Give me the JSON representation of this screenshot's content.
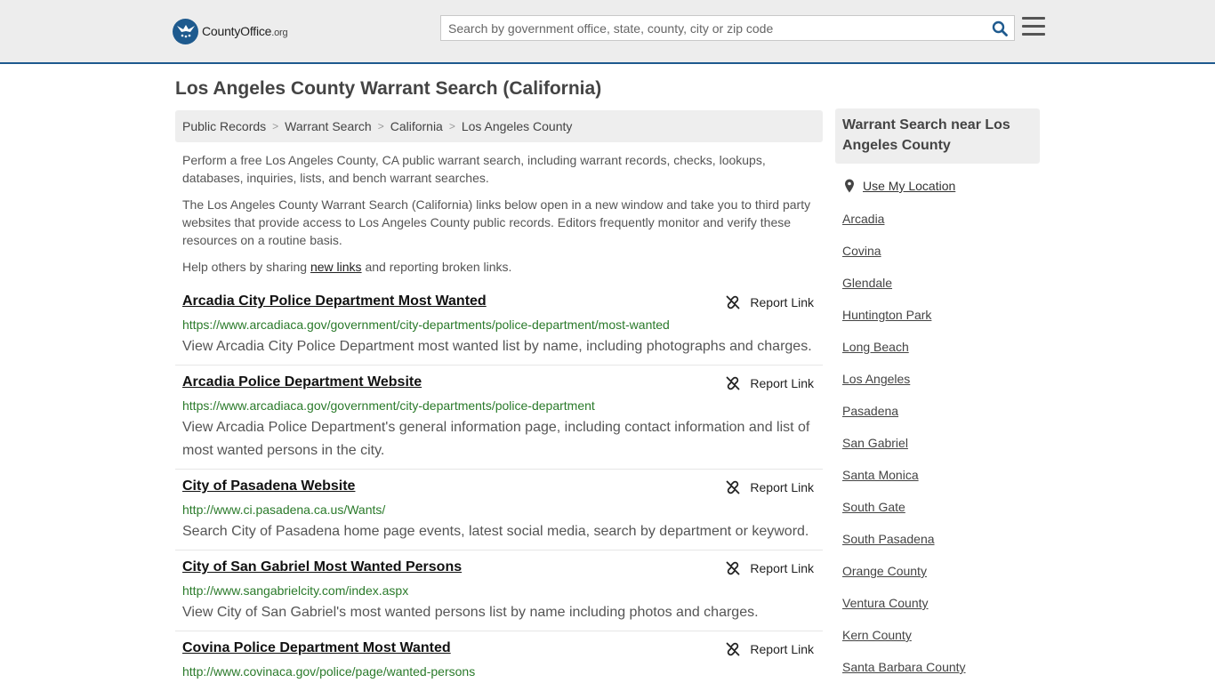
{
  "header": {
    "logo_name": "CountyOffice",
    "logo_tld": ".org",
    "search_placeholder": "Search by government office, state, county, city or zip code"
  },
  "page": {
    "title": "Los Angeles County Warrant Search (California)"
  },
  "breadcrumb": [
    "Public Records",
    "Warrant Search",
    "California",
    "Los Angeles County"
  ],
  "intro": {
    "p1": "Perform a free Los Angeles County, CA public warrant search, including warrant records, checks, lookups, databases, inquiries, lists, and bench warrant searches.",
    "p2": "The Los Angeles County Warrant Search (California) links below open in a new window and take you to third party websites that provide access to Los Angeles County public records. Editors frequently monitor and verify these resources on a routine basis.",
    "p3_before": "Help others by sharing ",
    "p3_link": "new links",
    "p3_after": " and reporting broken links."
  },
  "report_label": "Report Link",
  "results": [
    {
      "title": "Arcadia City Police Department Most Wanted",
      "url": "https://www.arcadiaca.gov/government/city-departments/police-department/most-wanted",
      "desc": "View Arcadia City Police Department most wanted list by name, including photographs and charges."
    },
    {
      "title": "Arcadia Police Department Website",
      "url": "https://www.arcadiaca.gov/government/city-departments/police-department",
      "desc": "View Arcadia Police Department's general information page, including contact information and list of most wanted persons in the city."
    },
    {
      "title": "City of Pasadena Website",
      "url": "http://www.ci.pasadena.ca.us/Wants/",
      "desc": "Search City of Pasadena home page events, latest social media, search by department or keyword."
    },
    {
      "title": "City of San Gabriel Most Wanted Persons",
      "url": "http://www.sangabrielcity.com/index.aspx",
      "desc": "View City of San Gabriel's most wanted persons list by name including photos and charges."
    },
    {
      "title": "Covina Police Department Most Wanted",
      "url": "http://www.covinaca.gov/police/page/wanted-persons",
      "desc": ""
    }
  ],
  "sidebar": {
    "heading": "Warrant Search near Los Angeles County",
    "use_location": "Use My Location",
    "links": [
      "Arcadia",
      "Covina",
      "Glendale",
      "Huntington Park",
      "Long Beach",
      "Los Angeles",
      "Pasadena",
      "San Gabriel",
      "Santa Monica",
      "South Gate",
      "South Pasadena",
      "Orange County",
      "Ventura County",
      "Kern County",
      "Santa Barbara County"
    ]
  },
  "colors": {
    "brand": "#1e5a8e",
    "url_green": "#2a7a2a",
    "header_bg": "#ededed"
  }
}
